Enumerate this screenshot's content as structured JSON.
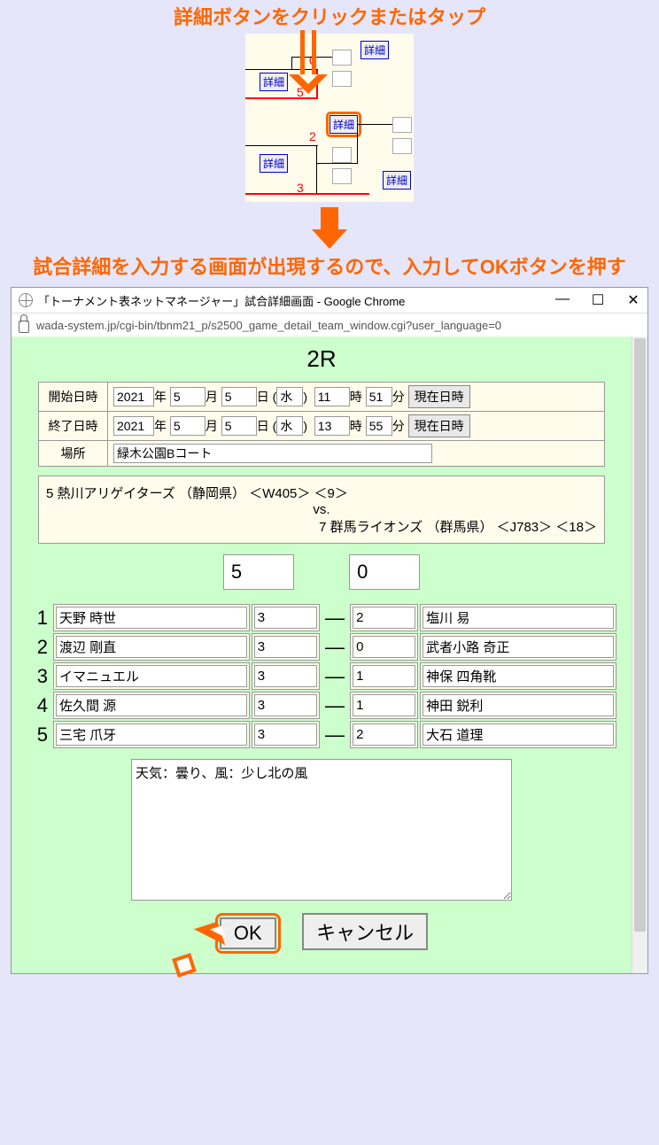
{
  "captions": {
    "top": "詳細ボタンをクリックまたはタップ",
    "bottom": "試合詳細を入力する画面が出現するので、入力してOKボタンを押す"
  },
  "bracket": {
    "detail_label": "詳細",
    "scores": [
      "0",
      "5",
      "2",
      "3"
    ]
  },
  "browser": {
    "title": "「トーナメント表ネットマネージャー」試合詳細画面 - Google Chrome",
    "url": "wada-system.jp/cgi-bin/tbnm21_p/s2500_game_detail_team_window.cgi?user_language=0"
  },
  "round": "2R",
  "labels": {
    "start": "開始日時",
    "end": "終了日時",
    "year": "年",
    "month": "月",
    "day": "日",
    "hour": "時",
    "min": "分",
    "now": "現在日時",
    "place": "場所",
    "vs": "vs.",
    "ok": "OK",
    "cancel": "キャンセル"
  },
  "start": {
    "year": "2021",
    "month": "5",
    "day": "5",
    "dow": "水",
    "hour": "11",
    "min": "51"
  },
  "end": {
    "year": "2021",
    "month": "5",
    "day": "5",
    "dow": "水",
    "hour": "13",
    "min": "55"
  },
  "place": "緑木公園Bコート",
  "matchup": {
    "team_a": "5 熱川アリゲイターズ （静岡県） ＜W405＞ ＜9＞",
    "team_b": "7 群馬ライオンズ （群馬県） ＜J783＞ ＜18＞"
  },
  "total": {
    "a": "5",
    "b": "0"
  },
  "games": [
    {
      "n": "1",
      "pa": "天野 時世",
      "sa": "3",
      "sb": "2",
      "pb": "塩川 易"
    },
    {
      "n": "2",
      "pa": "渡辺 剛直",
      "sa": "3",
      "sb": "0",
      "pb": "武者小路 奇正"
    },
    {
      "n": "3",
      "pa": "イマニュエル",
      "sa": "3",
      "sb": "1",
      "pb": "神保 四角靴"
    },
    {
      "n": "4",
      "pa": "佐久間 源",
      "sa": "3",
      "sb": "1",
      "pb": "神田 鋭利"
    },
    {
      "n": "5",
      "pa": "三宅 爪牙",
      "sa": "3",
      "sb": "2",
      "pb": "大石 道理"
    }
  ],
  "comment": "天気：曇り、風：少し北の風"
}
